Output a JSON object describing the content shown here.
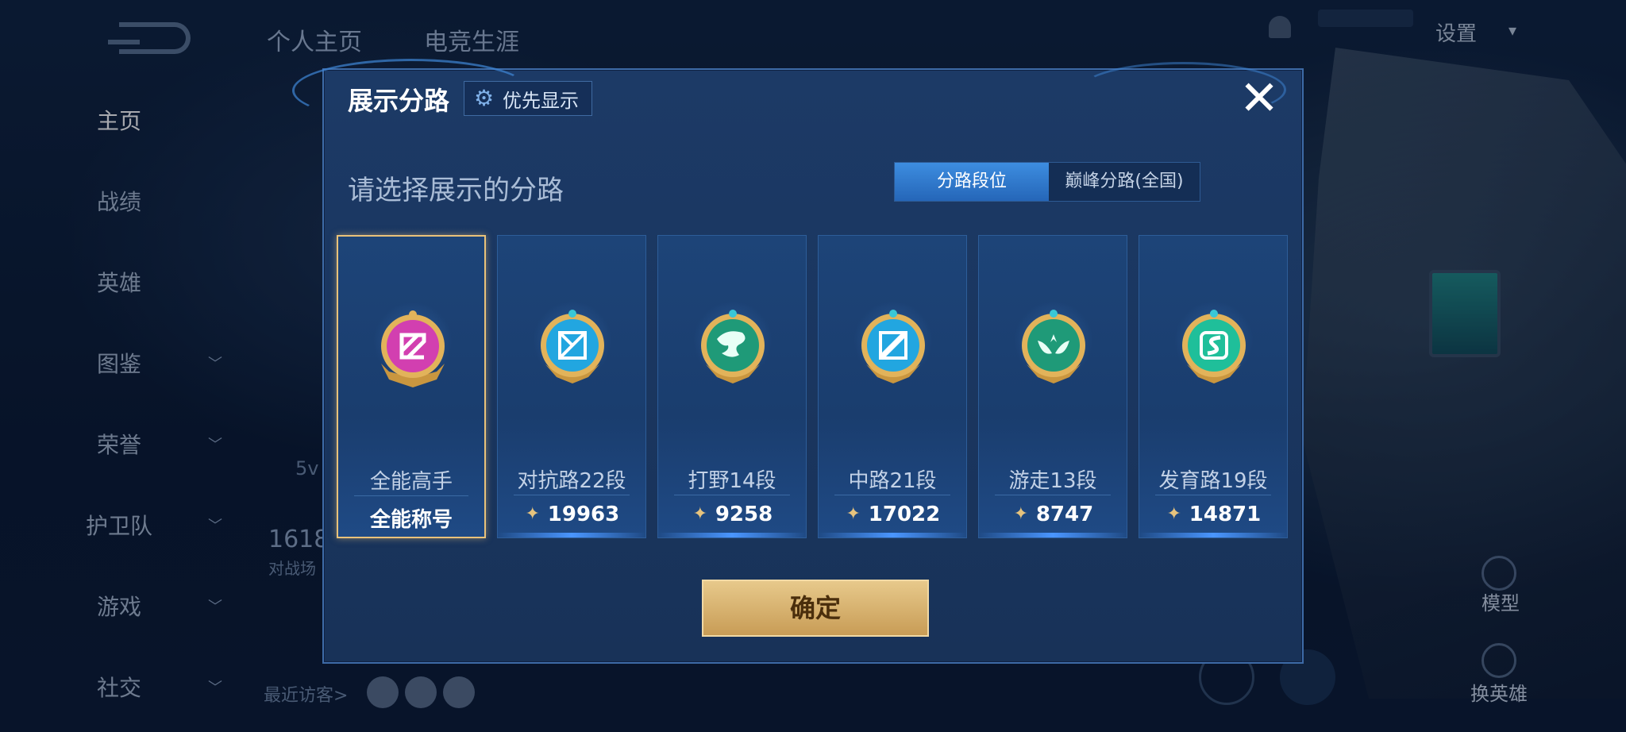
{
  "background": {
    "top_tabs": [
      "个人主页",
      "电竞生涯"
    ],
    "settings_label": "设置",
    "left_nav": [
      {
        "label": "主页",
        "chevron": false,
        "active": true
      },
      {
        "label": "战绩",
        "chevron": false,
        "active": false
      },
      {
        "label": "英雄",
        "chevron": false,
        "active": false
      },
      {
        "label": "图鉴",
        "chevron": true,
        "active": false
      },
      {
        "label": "荣誉",
        "chevron": true,
        "active": false
      },
      {
        "label": "护卫队",
        "chevron": true,
        "active": false
      },
      {
        "label": "游戏",
        "chevron": true,
        "active": false
      },
      {
        "label": "社交",
        "chevron": true,
        "active": false
      }
    ],
    "stat_number": "1618",
    "stat_label": "对战场",
    "mode_label": "5v",
    "recent_visitors": "最近访客>",
    "model_label": "模型",
    "switch_hero_label": "换英雄"
  },
  "modal": {
    "title": "展示分路",
    "priority_button": "优先显示",
    "subtitle": "请选择展示的分路",
    "segments": [
      {
        "label": "分路段位",
        "active": true
      },
      {
        "label": "巅峰分路(全国)",
        "active": false
      }
    ],
    "cards": [
      {
        "name": "全能高手",
        "score": "全能称号",
        "has_trophy": false,
        "selected": true,
        "badge_color": "#d23fb0",
        "badge_icon": "allround"
      },
      {
        "name": "对抗路22段",
        "score": "19963",
        "has_trophy": true,
        "selected": false,
        "badge_color": "#22a6e0",
        "badge_icon": "sword"
      },
      {
        "name": "打野14段",
        "score": "9258",
        "has_trophy": true,
        "selected": false,
        "badge_color": "#1f9a78",
        "badge_icon": "dragon"
      },
      {
        "name": "中路21段",
        "score": "17022",
        "has_trophy": true,
        "selected": false,
        "badge_color": "#22a6e0",
        "badge_icon": "staff"
      },
      {
        "name": "游走13段",
        "score": "8747",
        "has_trophy": true,
        "selected": false,
        "badge_color": "#1f9a78",
        "badge_icon": "wings"
      },
      {
        "name": "发育路19段",
        "score": "14871",
        "has_trophy": true,
        "selected": false,
        "badge_color": "#1fbf9a",
        "badge_icon": "arrow"
      }
    ],
    "confirm_label": "确定"
  }
}
